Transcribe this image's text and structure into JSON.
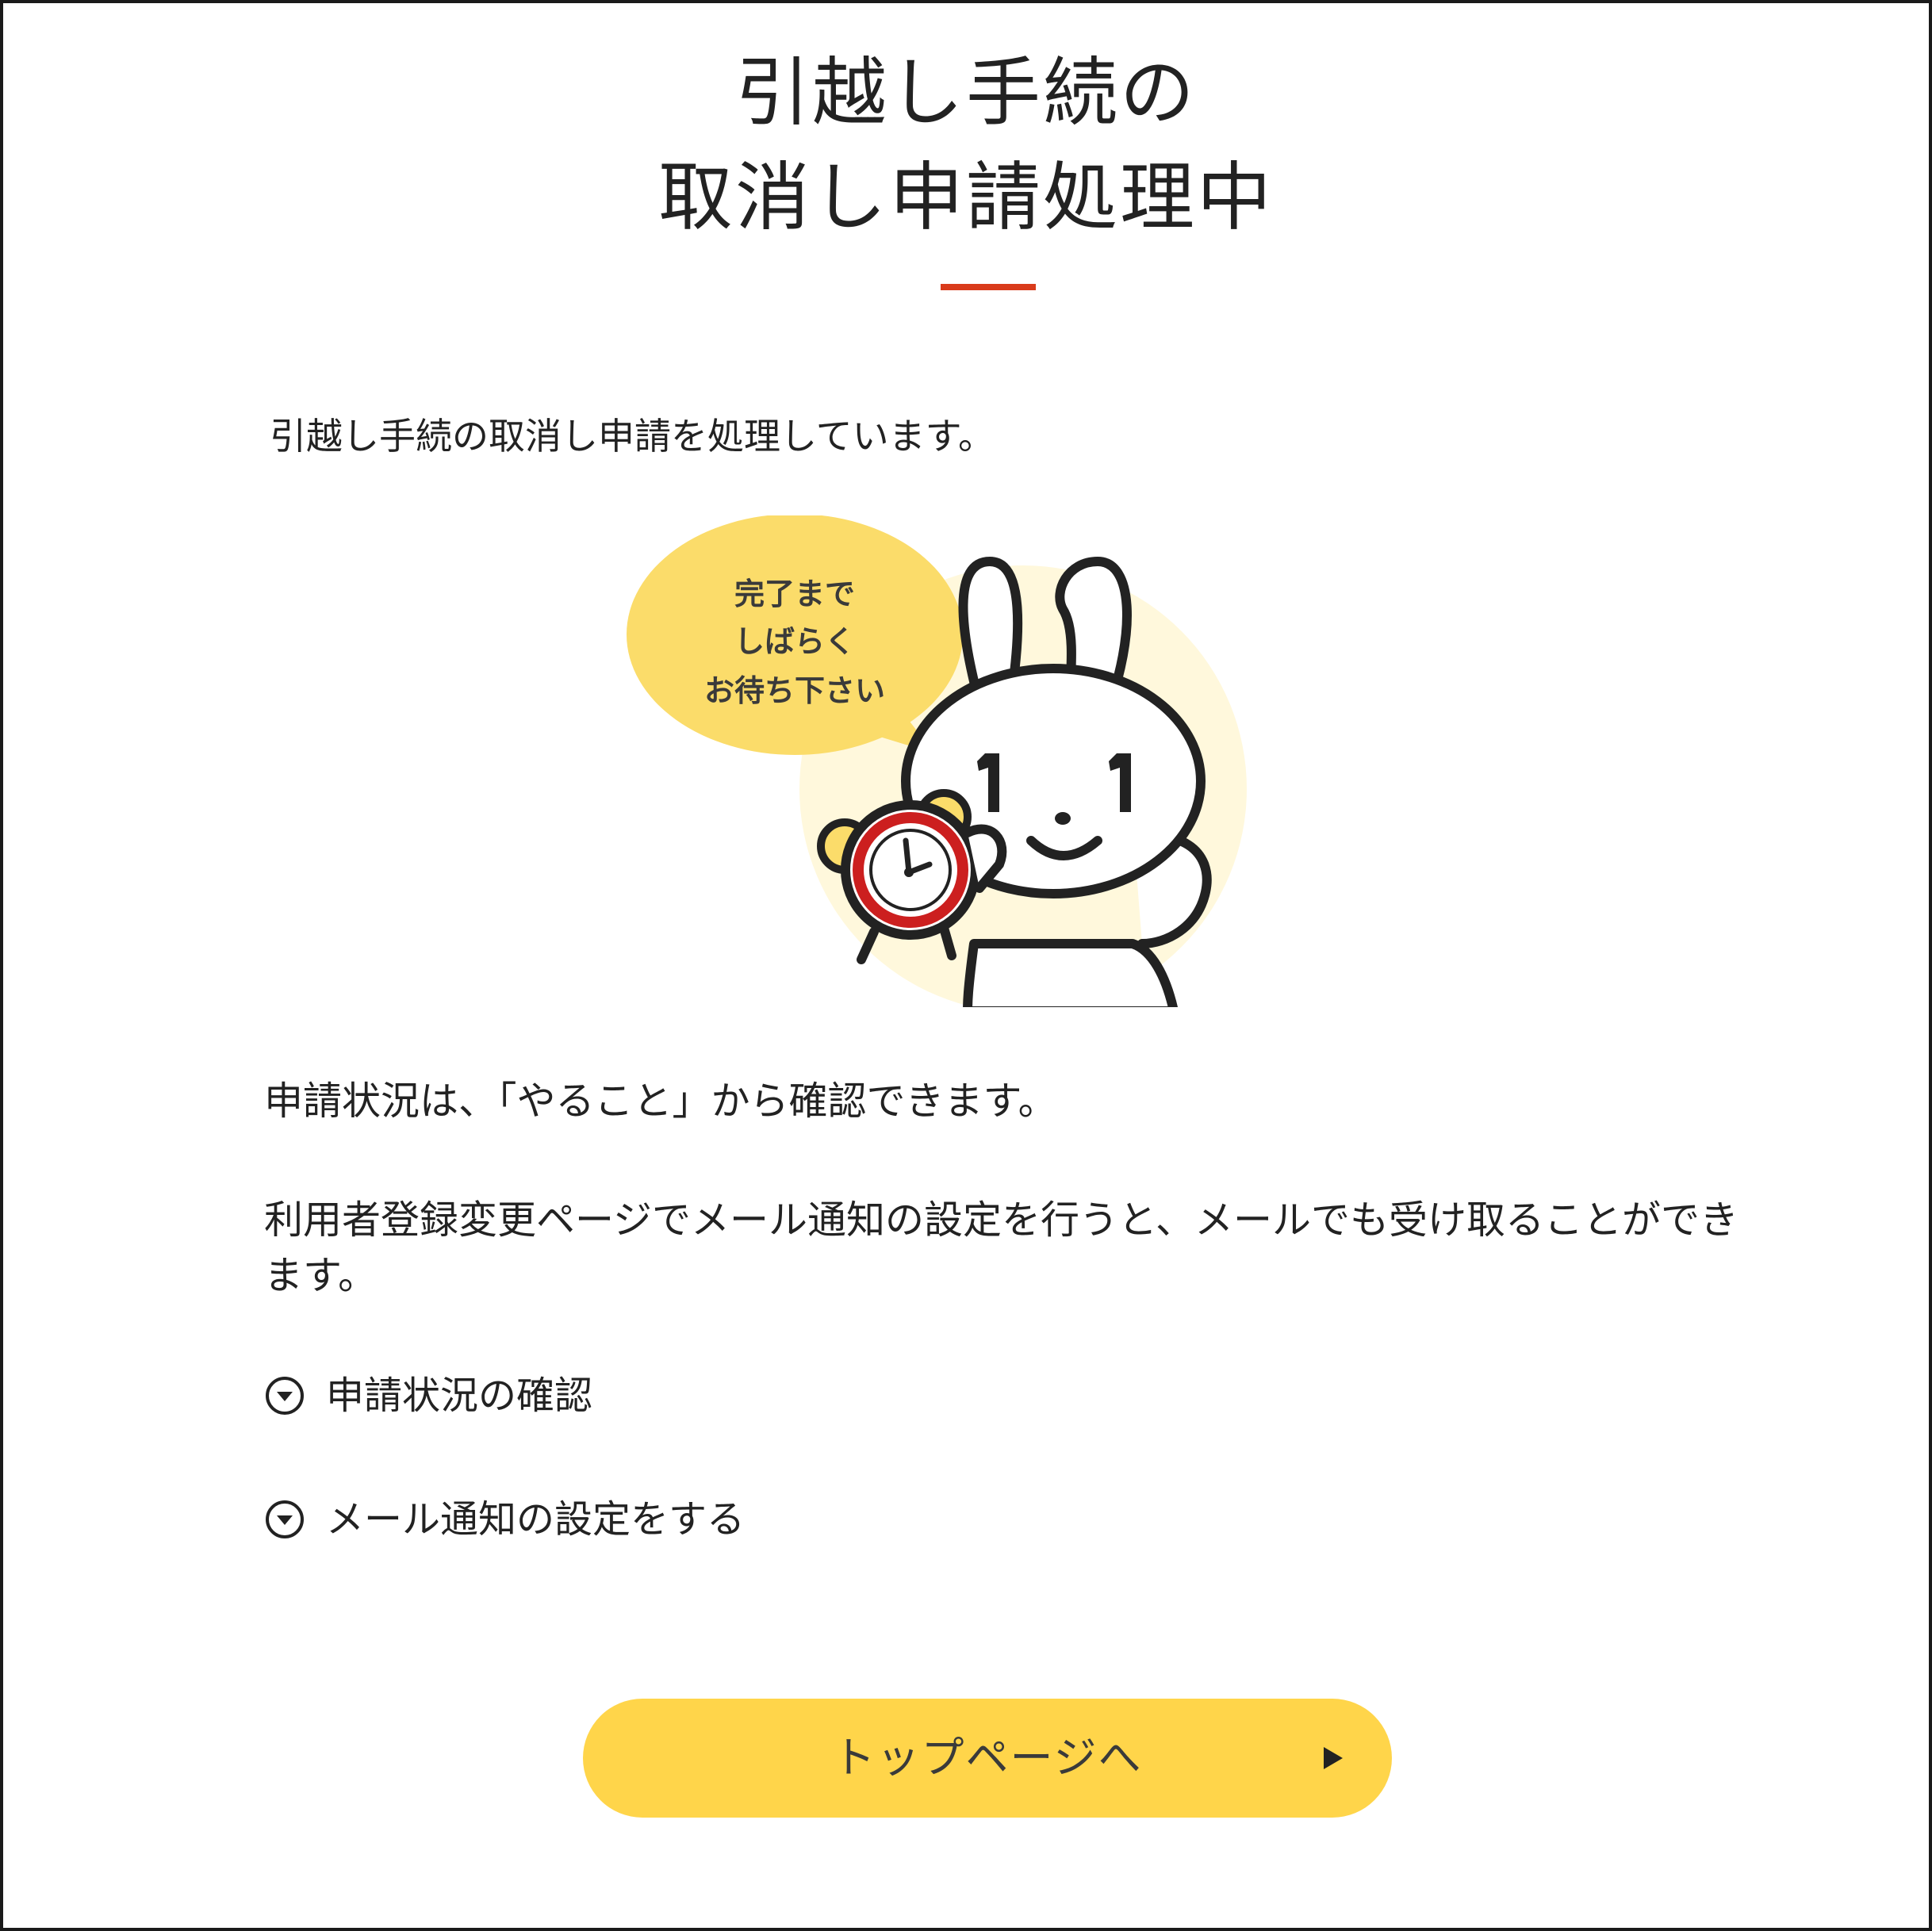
{
  "page": {
    "title_line1": "引越し手続の",
    "title_line2": "取消し申請処理中",
    "lead": "引越し手続の取消し申請を処理しています。",
    "illustration": {
      "bubble_line1": "完了まで",
      "bubble_line2": "しばらく",
      "bubble_line3": "お待ち下さい"
    },
    "status_text": "申請状況は、「やること」から確認できます。",
    "mail_text": "利用者登録変更ページでメール通知の設定を行うと、メールでも受け取ることができます。",
    "links": [
      {
        "label": "申請状況の確認",
        "icon": "chevron-down-circle-icon"
      },
      {
        "label": "メール通知の設定をする",
        "icon": "chevron-down-circle-icon"
      }
    ],
    "top_button_label": "トップページへ",
    "top_button_icon": "triangle-right-icon"
  },
  "colors": {
    "accent_rule": "#d93b1b",
    "button_bg": "#ffd54a",
    "bubble": "#fbdc6a",
    "clock_ring": "#cc1f1f",
    "halo": "#fff8dc"
  }
}
